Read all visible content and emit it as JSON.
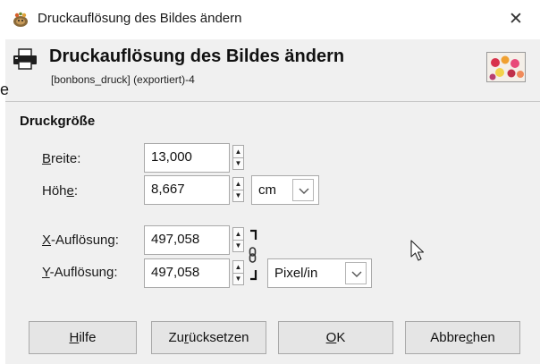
{
  "window": {
    "title": "Druckauflösung des Bildes ändern",
    "close_glyph": "✕"
  },
  "header": {
    "title": "Druckauflösung des Bildes ändern",
    "subtitle": "[bonbons_druck] (exportiert)-4",
    "stray_char": "e"
  },
  "section": {
    "title": "Druckgröße"
  },
  "fields": {
    "width": {
      "label_pre": "",
      "label_mnemonic": "B",
      "label_post": "reite:",
      "value": "13,000"
    },
    "height": {
      "label_pre": "Höh",
      "label_mnemonic": "e",
      "label_post": ":",
      "value": "8,667"
    },
    "x_resolution": {
      "label_pre": "",
      "label_mnemonic": "X",
      "label_post": "-Auflösung:",
      "value": "497,058"
    },
    "y_resolution": {
      "label_pre": "",
      "label_mnemonic": "Y",
      "label_post": "-Auflösung:",
      "value": "497,058"
    }
  },
  "size_unit": {
    "selected": "cm"
  },
  "resolution_unit": {
    "selected": "Pixel/in"
  },
  "buttons": {
    "help": {
      "pre": "",
      "mnemonic": "H",
      "post": "ilfe"
    },
    "reset": {
      "pre": "Zu",
      "mnemonic": "r",
      "post": "ücksetzen"
    },
    "ok": {
      "pre": "",
      "mnemonic": "O",
      "post": "K"
    },
    "cancel": {
      "pre": "Abbre",
      "mnemonic": "c",
      "post": "hen"
    }
  },
  "colors": {
    "dialog_bg": "#f0f0f0",
    "button_bg": "#e5e5e5",
    "border": "#a9a9a9"
  },
  "icons": {
    "app": "gimp-wilber-icon",
    "header": "printer-icon",
    "thumbnail": "image-thumbnail",
    "chain": "chain-link-icon",
    "cursor": "mouse-pointer-icon"
  }
}
